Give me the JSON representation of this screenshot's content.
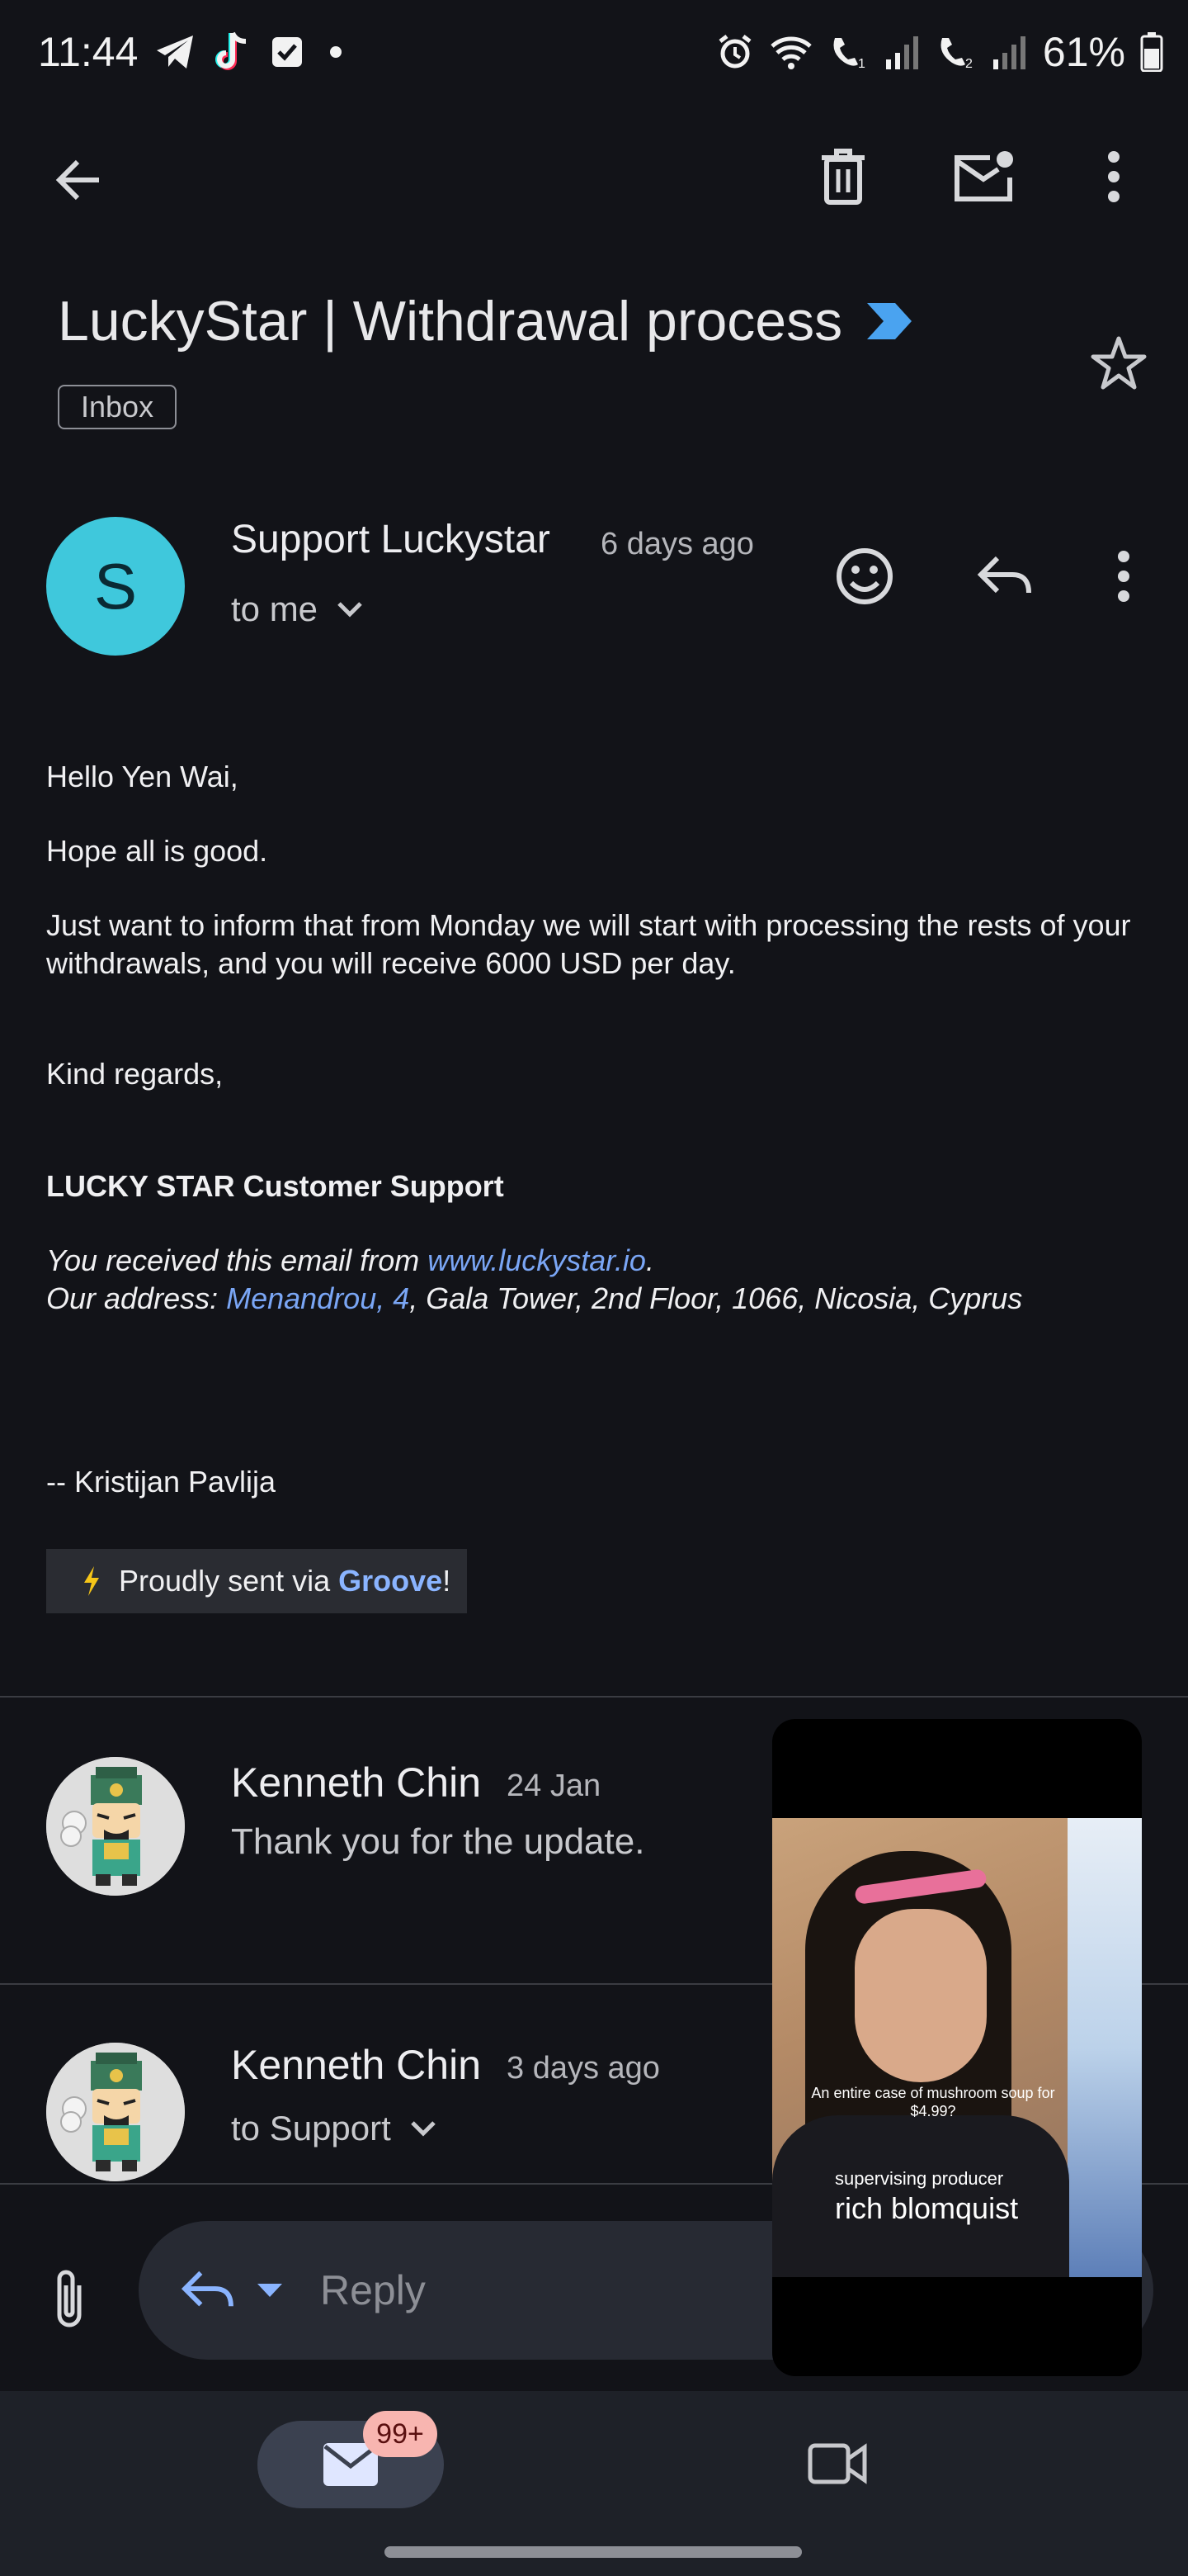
{
  "status_bar": {
    "time": "11:44",
    "battery_percent": "61%",
    "left_icons": [
      "telegram-icon",
      "tiktok-icon",
      "checkbox-icon",
      "dot-icon"
    ],
    "right_icons": [
      "alarm-icon",
      "wifi-icon",
      "call-sim1-icon",
      "signal-icon",
      "call-sim2-icon",
      "signal-icon",
      "battery-icon"
    ]
  },
  "toolbar": {
    "back_icon": "arrow-left-icon",
    "delete_icon": "trash-icon",
    "mark_unread_icon": "mail-unread-icon",
    "more_icon": "more-vert-icon"
  },
  "email": {
    "subject": "LuckyStar | Withdrawal process",
    "label": "Inbox",
    "important_marker": "importance-chevron-icon",
    "sender": {
      "initial": "S",
      "name": "Support Luckystar",
      "time": "6 days ago",
      "recipient": "to me"
    },
    "body": {
      "greeting": "Hello Yen Wai,",
      "line1": "Hope all is good.",
      "line2": "Just want to inform that from Monday we will start with processing the rests of your withdrawals, and you will receive 6000 USD per day.",
      "closing": "Kind regards,",
      "team": "LUCKY STAR Customer Support",
      "received_prefix": "You received this email from ",
      "received_link": "www.luckystar.io",
      "received_suffix": ".",
      "address_prefix": "Our address: ",
      "address_link": "Menandrou, 4",
      "address_suffix": ", Gala Tower, 2nd Floor, 1066, Nicosia, Cyprus",
      "signature": "-- Kristijan Pavlija",
      "groove_prefix": "Proudly sent via ",
      "groove_name": "Groove",
      "groove_suffix": "!"
    }
  },
  "thread": [
    {
      "name": "Kenneth Chin",
      "date": "24 Jan",
      "snippet": "Thank you for the update."
    },
    {
      "name": "Kenneth Chin",
      "date": "3 days ago",
      "snippet": "to Support"
    }
  ],
  "reply_bar": {
    "placeholder": "Reply"
  },
  "bottom_nav": {
    "mail_badge": "99+"
  },
  "pip_video": {
    "caption": "An entire case of mushroom soup for $4.99?",
    "role": "supervising producer",
    "name": "rich blomquist"
  },
  "colors": {
    "background": "#121318",
    "avatar_s": "#3fc8dc",
    "link": "#7aa6f5",
    "groove": "#8ab4ff",
    "badge": "#f8b5b0"
  }
}
